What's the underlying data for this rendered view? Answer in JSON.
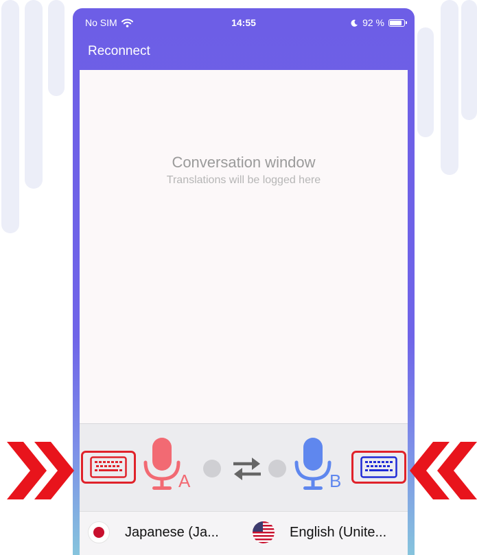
{
  "status_bar": {
    "carrier": "No SIM",
    "time": "14:55",
    "battery": "92 %",
    "battery_level": 0.92
  },
  "nav": {
    "reconnect_label": "Reconnect"
  },
  "conversation": {
    "title": "Conversation window",
    "subtitle": "Translations will be logged here"
  },
  "controls": {
    "mic_a_letter": "A",
    "mic_b_letter": "B",
    "left_keyboard_color": "#e0222a",
    "right_keyboard_color": "#1f2bd6",
    "mic_a_color": "#f26a73",
    "mic_b_color": "#5f87ee"
  },
  "languages": {
    "left": "Japanese (Ja...",
    "right": "English (Unite..."
  },
  "colors": {
    "header": "#6d5ee6",
    "highlight_red": "#e0222a"
  }
}
